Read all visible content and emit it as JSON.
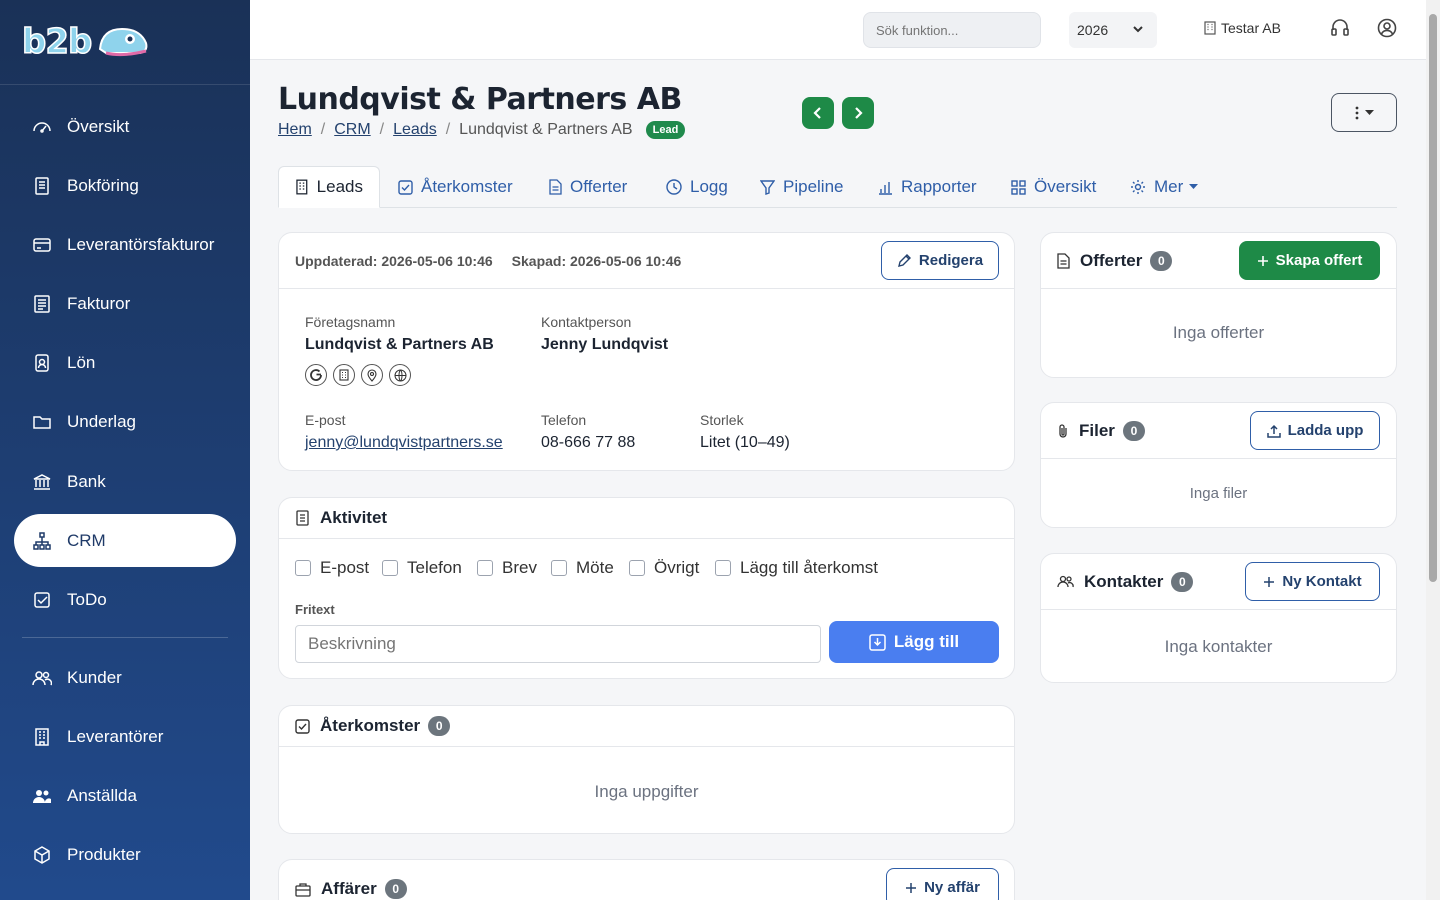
{
  "logo": {
    "text": "b2b"
  },
  "sidebar": {
    "items": [
      {
        "label": "Översikt",
        "icon": "dashboard-icon"
      },
      {
        "label": "Bokföring",
        "icon": "ledger-icon"
      },
      {
        "label": "Leverantörsfakturor",
        "icon": "credit-card-icon"
      },
      {
        "label": "Fakturor",
        "icon": "invoice-icon"
      },
      {
        "label": "Lön",
        "icon": "badge-icon"
      },
      {
        "label": "Underlag",
        "icon": "folder-icon"
      },
      {
        "label": "Bank",
        "icon": "bank-icon"
      },
      {
        "label": "CRM",
        "icon": "diagram-icon",
        "active": true
      },
      {
        "label": "ToDo",
        "icon": "checkbox-icon"
      },
      {
        "label": "Kunder",
        "icon": "people-icon"
      },
      {
        "label": "Leverantörer",
        "icon": "building-icon"
      },
      {
        "label": "Anställda",
        "icon": "people-fill-icon"
      },
      {
        "label": "Produkter",
        "icon": "box-icon"
      }
    ]
  },
  "topbar": {
    "search_placeholder": "Sök funktion...",
    "year": "2026",
    "company": "Testar AB"
  },
  "page": {
    "title": "Lundqvist & Partners AB",
    "breadcrumb": [
      "Hem",
      "CRM",
      "Leads",
      "Lundqvist & Partners AB"
    ],
    "badge": "Lead"
  },
  "tabs": [
    {
      "label": "Leads",
      "icon": "building-icon",
      "active": true
    },
    {
      "label": "Återkomster",
      "icon": "checkbox-icon"
    },
    {
      "label": "Offerter",
      "icon": "document-icon"
    },
    {
      "label": "Logg",
      "icon": "clock-icon"
    },
    {
      "label": "Pipeline",
      "icon": "funnel-icon"
    },
    {
      "label": "Rapporter",
      "icon": "bar-chart-icon"
    },
    {
      "label": "Översikt",
      "icon": "grid-icon"
    },
    {
      "label": "Mer",
      "icon": "gear-icon"
    }
  ],
  "lead_card": {
    "updated": "Uppdaterad: 2026-05-06 10:46",
    "created": "Skapad: 2026-05-06 10:46",
    "edit_label": "Redigera",
    "company_label": "Företagsnamn",
    "company_value": "Lundqvist & Partners AB",
    "contact_label": "Kontaktperson",
    "contact_value": "Jenny Lundqvist",
    "email_label": "E-post",
    "email_value": "jenny@lundqvistpartners.se",
    "phone_label": "Telefon",
    "phone_value": "08-666 77 88",
    "size_label": "Storlek",
    "size_value": "Litet (10–49)"
  },
  "activity": {
    "title": "Aktivitet",
    "checkboxes": [
      "E-post",
      "Telefon",
      "Brev",
      "Möte",
      "Övrigt",
      "Lägg till återkomst"
    ],
    "fritext_label": "Fritext",
    "placeholder": "Beskrivning",
    "add_label": "Lägg till"
  },
  "aterkomster": {
    "title": "Återkomster",
    "count": "0",
    "empty": "Inga uppgifter"
  },
  "affarer": {
    "title": "Affärer",
    "count": "0",
    "new_label": "Ny affär"
  },
  "offerter": {
    "title": "Offerter",
    "count": "0",
    "create_label": "Skapa offert",
    "empty": "Inga offerter"
  },
  "filer": {
    "title": "Filer",
    "count": "0",
    "upload_label": "Ladda upp",
    "empty": "Inga filer"
  },
  "kontakter": {
    "title": "Kontakter",
    "count": "0",
    "new_label": "Ny Kontakt",
    "empty": "Inga kontakter"
  },
  "colors": {
    "sidebar_top": "#1a3157",
    "sidebar_bottom": "#214a8c",
    "accent_green": "#1e8a47",
    "accent_blue": "#4a7ef0",
    "link": "#24426e"
  }
}
